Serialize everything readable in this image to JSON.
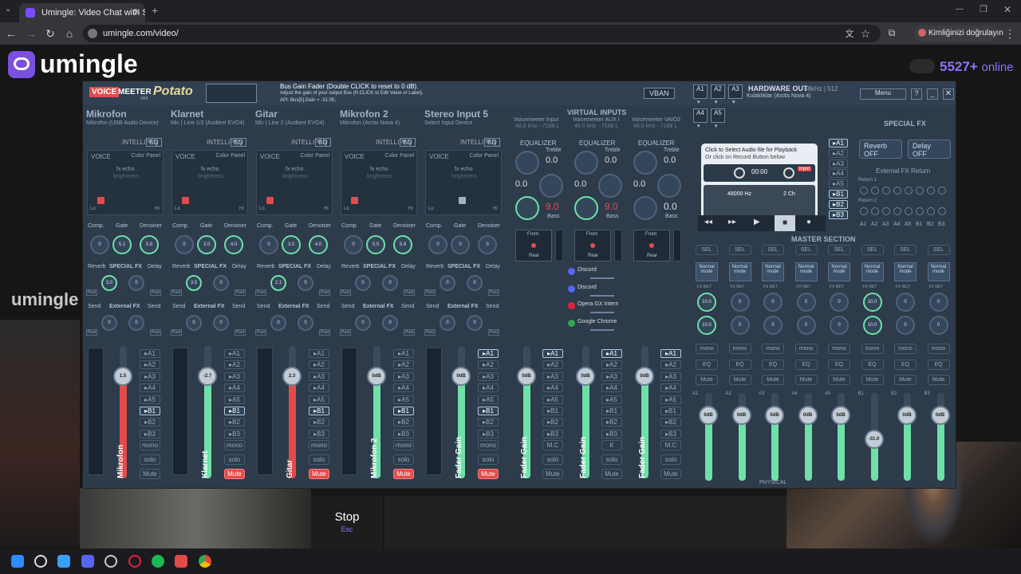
{
  "browser": {
    "tab_title": "Umingle: Video Chat with S",
    "url": "umingle.com/video/",
    "profile": "Kimliğinizi doğrulayın"
  },
  "site": {
    "logo": "umingle",
    "online_count": "5527+",
    "online_label": "online",
    "watermark": "umingle",
    "stop_label": "Stop",
    "stop_key": "Esc"
  },
  "voicemeeter": {
    "title_voice": "VOICE",
    "title_meeter": "MEETER",
    "title_potato": "Potato",
    "title_x64": "x64",
    "bus_gain_title": "Bus Gain Fader (Double CLICK to reset to 0 dB).",
    "bus_gain_help": "Adjust the gain of your output Bus (R.CLICK to Edit Value or Label).",
    "api_line": "API: Bus[5].Gain = -31.05;",
    "vban": "VBAN",
    "hardware_out": "HARDWARE OUT",
    "hardware_rate": "48kHz | 512",
    "hardware_device": "Kulaklıklar (Arctis Nova 4)",
    "menu": "Menu",
    "special_fx": "SPECIAL FX",
    "reverb": "Reverb",
    "delay": "Delay",
    "off": "OFF",
    "external_fx_return": "External FX Return",
    "return1": "Return 1",
    "return2": "Return 2",
    "master_section": "MASTER SECTION",
    "physical": "PHYSICAL",
    "virtual_inputs": "VIRTUAL INPUTS",
    "recorder_line1": "Click to Select Audio file for Playback",
    "recorder_line2": "Or click on Record Button below",
    "recorder_time": "00:00",
    "recorder_rate": "48000 Hz",
    "recorder_ch": "2 Ch",
    "recorder_input": "input",
    "hw_buses": [
      "A1",
      "A2",
      "A3",
      "A4",
      "A5"
    ],
    "ret_labels": [
      "A1",
      "A2",
      "A3",
      "A4",
      "A5",
      "B1",
      "B2",
      "B3"
    ],
    "labels": {
      "intellipan": "INTELLIPAN",
      "eq": "EQ",
      "voice": "VOICE",
      "color_panel": "Color Panel",
      "fx_echo": "fx echo",
      "brightness": "brightness",
      "lo": "Lo",
      "hi": "Hi",
      "comp": "Comp.",
      "gate": "Gate",
      "denoiser": "Denoiser",
      "reverb": "Reverb",
      "special_fx": "SPECIAL FX",
      "delay": "Delay",
      "send": "Send",
      "external_fx": "External FX",
      "post": "Post",
      "equalizer": "EQUALIZER",
      "treble": "Treble",
      "bass": "Bass",
      "front": "Front",
      "rear": "Rear",
      "mono": "mono",
      "solo": "solo",
      "mute": "Mute",
      "sel": "SEL",
      "normal_mode": "Normal mode",
      "fx_ret": "FX RET",
      "eq_btn": "EQ",
      "mc": "M.C",
      "k": "K"
    },
    "strips": [
      {
        "name": "Mikrofon",
        "device": "Mikrofon (USB Audio Device)",
        "comp": "0",
        "gate": "5.1",
        "denoiser": "5.8",
        "reverb": "3.0",
        "delay": "0",
        "send1": "0",
        "send2": "0",
        "gain": "1.5",
        "fader": "Mikrofon",
        "muted": false,
        "color": "#e34b4b"
      },
      {
        "name": "Klarnet",
        "device": "Mic | Line 1/2 (Audient EVO4)",
        "comp": "0",
        "gate": "3.0",
        "denoiser": "4.0",
        "reverb": "3.5",
        "delay": "0",
        "send1": "0",
        "send2": "0",
        "gain": "-2.7",
        "fader": "Klarnet",
        "muted": true,
        "color": "#6fe0a8"
      },
      {
        "name": "Gitar",
        "device": "Mic | Line 2 (Audient EVO4)",
        "comp": "0",
        "gate": "3.0",
        "denoiser": "4.0",
        "reverb": "2.1",
        "delay": "0",
        "send1": "0",
        "send2": "0",
        "gain": "2.3",
        "fader": "Gitar",
        "muted": true,
        "color": "#e34b4b"
      },
      {
        "name": "Mikrofon 2",
        "device": "Mikrofon (Arctis Nova 4)",
        "comp": "0",
        "gate": "5.5",
        "denoiser": "5.8",
        "reverb": "0",
        "delay": "0",
        "send1": "0",
        "send2": "0",
        "gain": "0dB",
        "fader": "Mikrofon 2",
        "muted": true,
        "color": "#6fe0a8"
      },
      {
        "name": "Stereo Input 5",
        "device": "Select Input Device",
        "comp": "0",
        "gate": "0",
        "denoiser": "0",
        "reverb": "0",
        "delay": "0",
        "send1": "0",
        "send2": "0",
        "gain": "0dB",
        "fader": "Fader Gain",
        "muted": true,
        "color": "#6fe0a8"
      }
    ],
    "virtual": [
      {
        "name": "Voicemeeter Input",
        "rate": "48.0 kHz - 7168 L",
        "treble": "0.0",
        "mid": "0.0",
        "bass": "9.0",
        "gain": "0dB",
        "fader": "Fader Gain"
      },
      {
        "name": "Voicemeeter AUX I",
        "rate": "48.0 kHz - 7168 L",
        "treble": "0.0",
        "mid": "0.0",
        "bass": "9.0",
        "gain": "0dB",
        "fader": "Fader Gain"
      },
      {
        "name": "Voicemeeter VAIO3",
        "rate": "48.0 kHz - 7168 L",
        "treble": "0.0",
        "mid": "0.0",
        "bass": "0.0",
        "gain": "0dB",
        "fader": "Fader Gain"
      }
    ],
    "apps": [
      "Discord",
      "Discord",
      "Opera GX Intern",
      "Google Chrome"
    ],
    "master": [
      {
        "bus": "A1",
        "fx1": "10.0",
        "fx2": "10.0",
        "gain": "0dB"
      },
      {
        "bus": "A2",
        "fx1": "0",
        "fx2": "0",
        "gain": "0dB"
      },
      {
        "bus": "A3",
        "fx1": "0",
        "fx2": "0",
        "gain": "0dB"
      },
      {
        "bus": "A4",
        "fx1": "0",
        "fx2": "0",
        "gain": "0dB"
      },
      {
        "bus": "A5",
        "fx1": "0",
        "fx2": "0",
        "gain": "0dB"
      },
      {
        "bus": "B1",
        "fx1": "10.0",
        "fx2": "10.0",
        "gain": "-31.0"
      },
      {
        "bus": "B2",
        "fx1": "0",
        "fx2": "0",
        "gain": "0dB"
      },
      {
        "bus": "B3",
        "fx1": "0",
        "fx2": "0",
        "gain": "0dB"
      }
    ]
  }
}
